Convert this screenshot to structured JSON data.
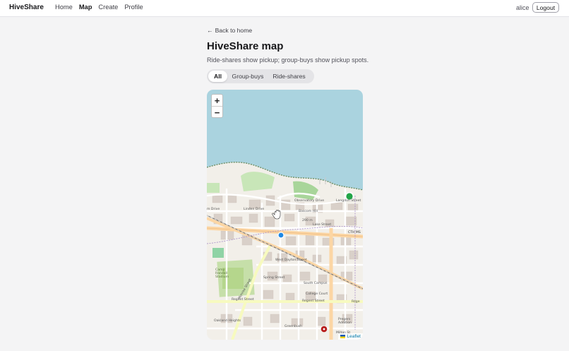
{
  "header": {
    "brand": "HiveShare",
    "nav": [
      "Home",
      "Map",
      "Create",
      "Profile"
    ],
    "active_nav": "Map",
    "username": "alice",
    "logout_label": "Logout"
  },
  "page": {
    "back_label": "Back to home",
    "back_icon": "arrow-left-icon",
    "title": "HiveShare map",
    "subtitle": "Ride-shares show pickup; group-buys show pickup spots."
  },
  "filters": {
    "options": [
      "All",
      "Group-buys",
      "Ride-shares"
    ],
    "selected": "All"
  },
  "map": {
    "zoom_in": "+",
    "zoom_out": "−",
    "attribution": "Leaflet",
    "labels": {
      "street_langdon": "Langdon Street",
      "drive_left": "m Drive",
      "linden": "Linden Drive",
      "observatory": "Observatory Drive",
      "bascom": "Bascom Hill",
      "hill_290": "290 m",
      "lake": "Lake Street",
      "cth": "CTH MS",
      "camp_randall": "Camp Randall Stadium",
      "dayton": "West Dayton Street",
      "spring": "Spring Street",
      "south_campus": "South Campus",
      "college": "College Court",
      "regent_a": "Regent Street",
      "regent_b": "Regent Street",
      "regent_c": "Rege",
      "monroe": "Monroe Street",
      "oakland": "Oakland Heights",
      "greenbush": "Greenbush",
      "pregers": "Pregers Addition",
      "milton": "Milton St"
    },
    "markers": [
      {
        "kind": "group-buy",
        "color": "#22a447"
      },
      {
        "kind": "ride-share",
        "color": "#1e88e5"
      },
      {
        "kind": "poi",
        "color": "#b71c1c"
      }
    ]
  }
}
